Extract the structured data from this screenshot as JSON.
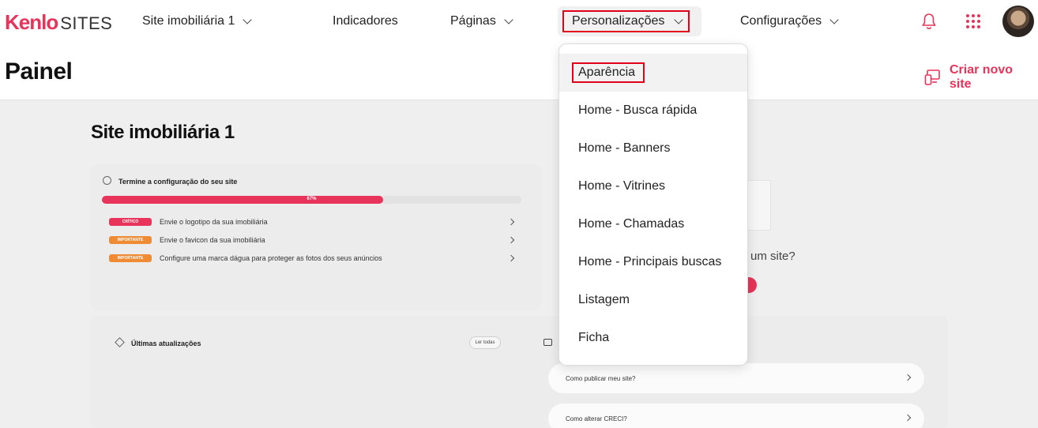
{
  "brand": {
    "logo_kenlo": "Kenlo",
    "logo_sites": "SITES",
    "accent": "#e8335a"
  },
  "nav": {
    "site_selector": "Site imobiliária 1",
    "indicadores": "Indicadores",
    "paginas": "Páginas",
    "personalizacoes": "Personalizações",
    "configuracoes": "Configurações",
    "icons": [
      "bell-icon",
      "apps-grid-icon",
      "avatar"
    ]
  },
  "header": {
    "title": "Painel",
    "new_site_label": "Criar novo site",
    "new_site_icon": "devices-icon"
  },
  "dropdown": {
    "items": [
      {
        "label": "Aparência",
        "active": true
      },
      {
        "label": "Home - Busca rápida"
      },
      {
        "label": "Home - Banners"
      },
      {
        "label": "Home - Vitrines"
      },
      {
        "label": "Home - Chamadas"
      },
      {
        "label": "Home - Principais buscas"
      },
      {
        "label": "Listagem"
      },
      {
        "label": "Ficha"
      }
    ]
  },
  "main": {
    "site_heading": "Site imobiliária 1",
    "setup": {
      "title": "Termine a configuração do seu site",
      "progress_percent": 67,
      "progress_label": "67%",
      "tasks": [
        {
          "badge": "CRÍTICO",
          "level": "critico",
          "text": "Envie o logotipo da sua imobiliária"
        },
        {
          "badge": "IMPORTANTE",
          "level": "importante",
          "text": "Envie o favicon da sua imobiliária"
        },
        {
          "badge": "IMPORTANTE",
          "level": "importante",
          "text": "Configure uma marca dágua para proteger as fotos dos seus anúncios"
        }
      ]
    },
    "partial_text": "um site?",
    "updates": {
      "title": "Últimas atualizações",
      "read_all": "Ler todas"
    },
    "faq": [
      {
        "text": "Como publicar meu site?"
      },
      {
        "text": "Como alterar CRECI?"
      }
    ]
  }
}
